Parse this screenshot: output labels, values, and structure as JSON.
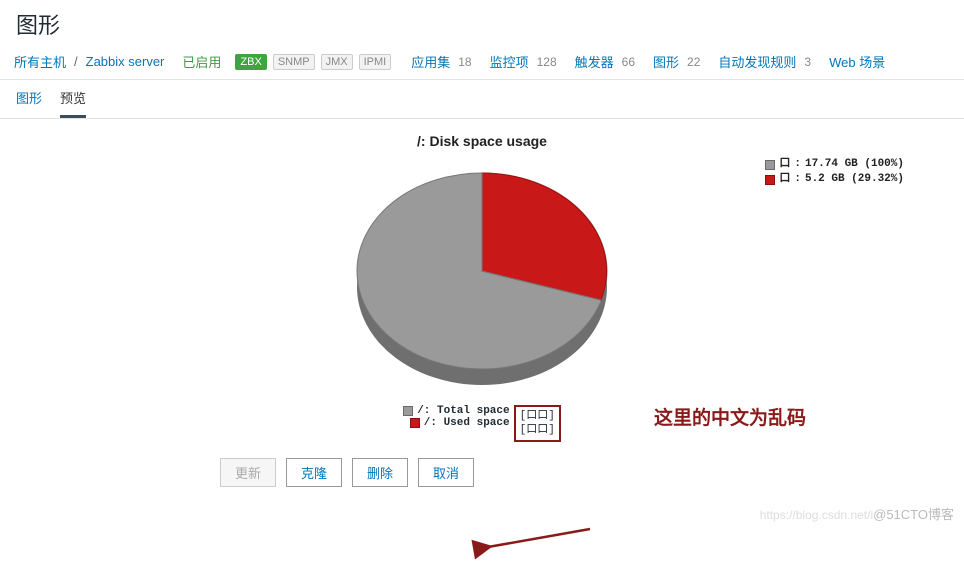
{
  "page_title": "图形",
  "breadcrumb": {
    "all_hosts": "所有主机",
    "host": "Zabbix server",
    "enabled": "已启用",
    "tags": {
      "zbx": "ZBX",
      "snmp": "SNMP",
      "jmx": "JMX",
      "ipmi": "IPMI"
    },
    "nav": {
      "apps": "应用集",
      "apps_n": "18",
      "items": "监控项",
      "items_n": "128",
      "triggers": "触发器",
      "triggers_n": "66",
      "graphs": "图形",
      "graphs_n": "22",
      "discovery": "自动发现规则",
      "discovery_n": "3",
      "web": "Web 场景"
    }
  },
  "tabs": {
    "tab1": "图形",
    "tab2": "预览"
  },
  "chart_data": {
    "type": "pie",
    "title": "/: Disk space usage",
    "series": [
      {
        "name": "/: Total space",
        "label": "口",
        "value_label": "17.74 GB (100%)",
        "value_gb": 17.74,
        "pct": 100,
        "color": "#9a9a9a"
      },
      {
        "name": "/: Used space",
        "label": "口",
        "value_label": "5.2 GB (29.32%)",
        "value_gb": 5.2,
        "pct": 29.32,
        "color": "#c81818"
      }
    ],
    "bottom_legend": {
      "total": {
        "name": "/: Total space",
        "garble": "[口口]"
      },
      "used": {
        "name": "/: Used space",
        "garble": "[口口]"
      }
    }
  },
  "annotation": {
    "text": "这里的中文为乱码"
  },
  "buttons": {
    "update": "更新",
    "clone": "克隆",
    "delete": "删除",
    "cancel": "取消"
  },
  "watermark": {
    "left": "https://blog.csdn.net/i",
    "right": "@51CTO博客"
  }
}
